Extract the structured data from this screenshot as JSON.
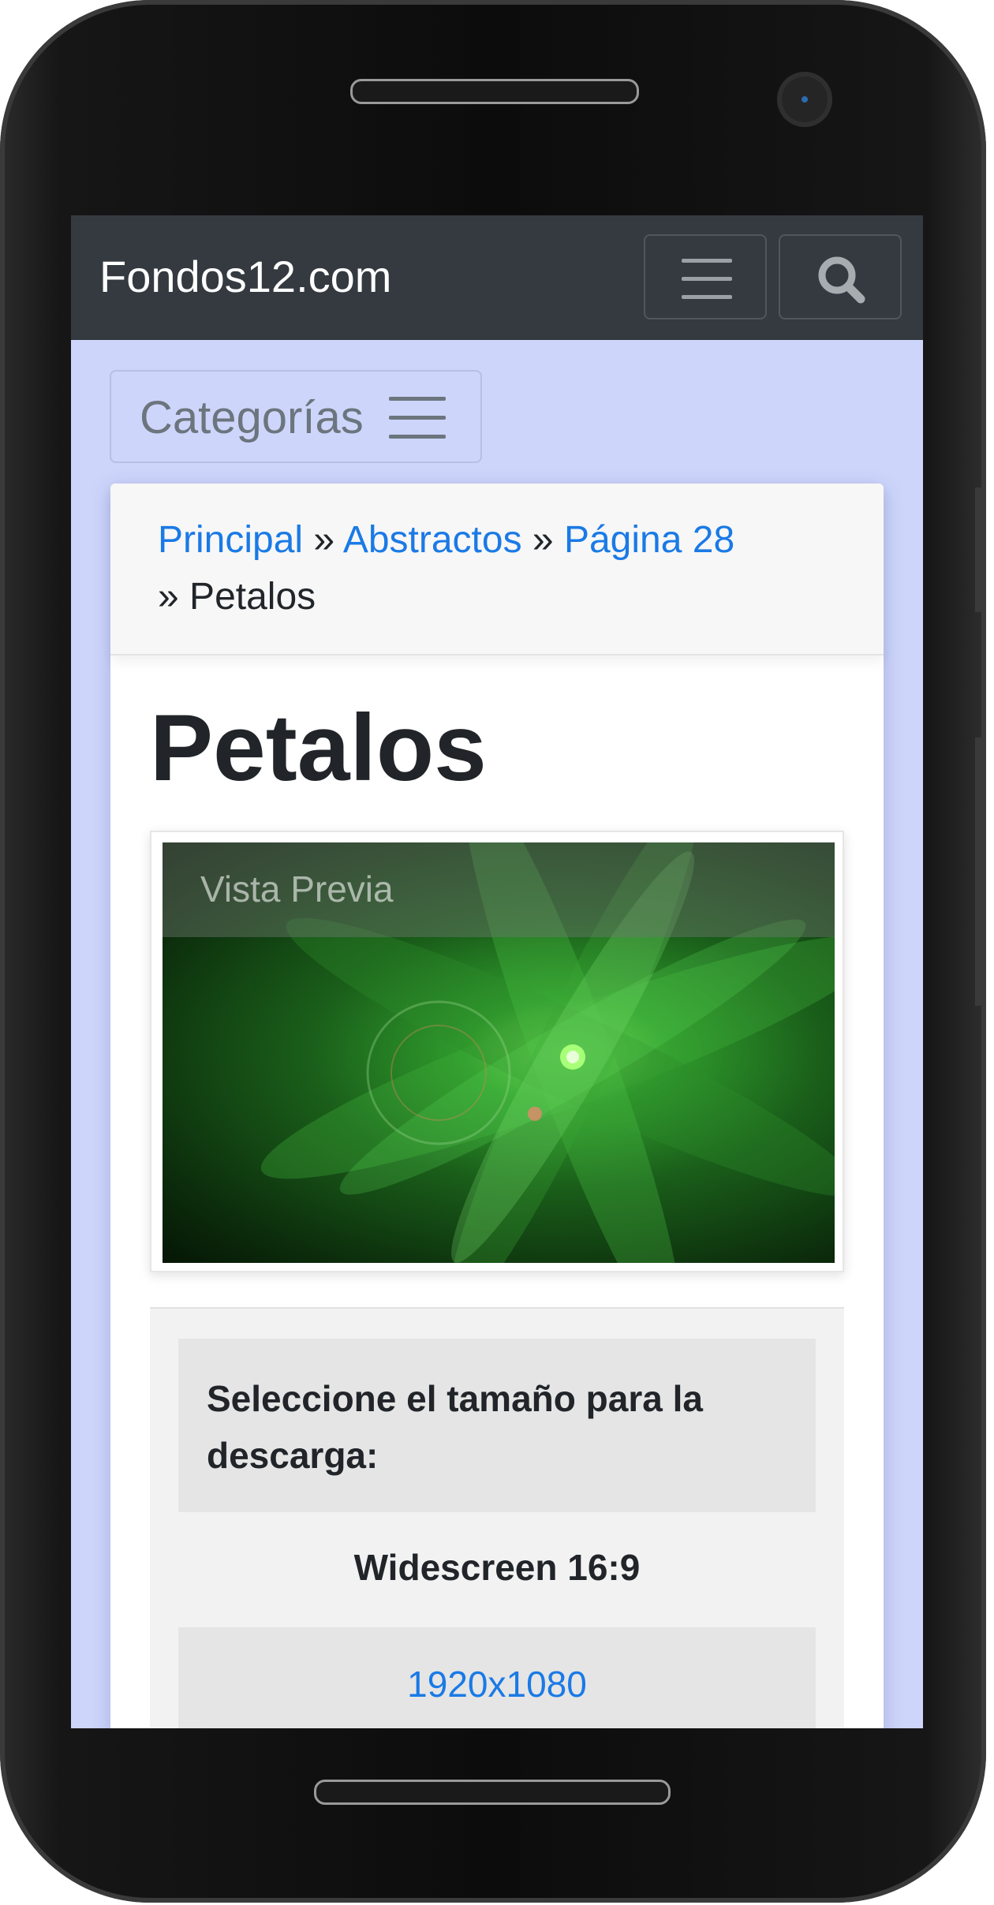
{
  "header": {
    "brand": "Fondos12.com",
    "menu_icon": "hamburger-icon",
    "search_icon": "search-icon"
  },
  "categories_button": {
    "label": "Categorías",
    "icon": "hamburger-icon"
  },
  "breadcrumb": {
    "items": [
      "Principal",
      "Abstractos",
      "Página 28"
    ],
    "separator": "»",
    "current": "Petalos"
  },
  "page_title": "Petalos",
  "preview": {
    "overlay_label": "Vista Previa"
  },
  "download": {
    "heading": "Seleccione el tamaño para la descarga:",
    "group_label": "Widescreen 16:9",
    "sizes": [
      "1920x1080"
    ]
  },
  "colors": {
    "navbar": "#343a40",
    "page_background": "#cdd5fb",
    "link": "#1a7ae6",
    "text": "#212529"
  }
}
